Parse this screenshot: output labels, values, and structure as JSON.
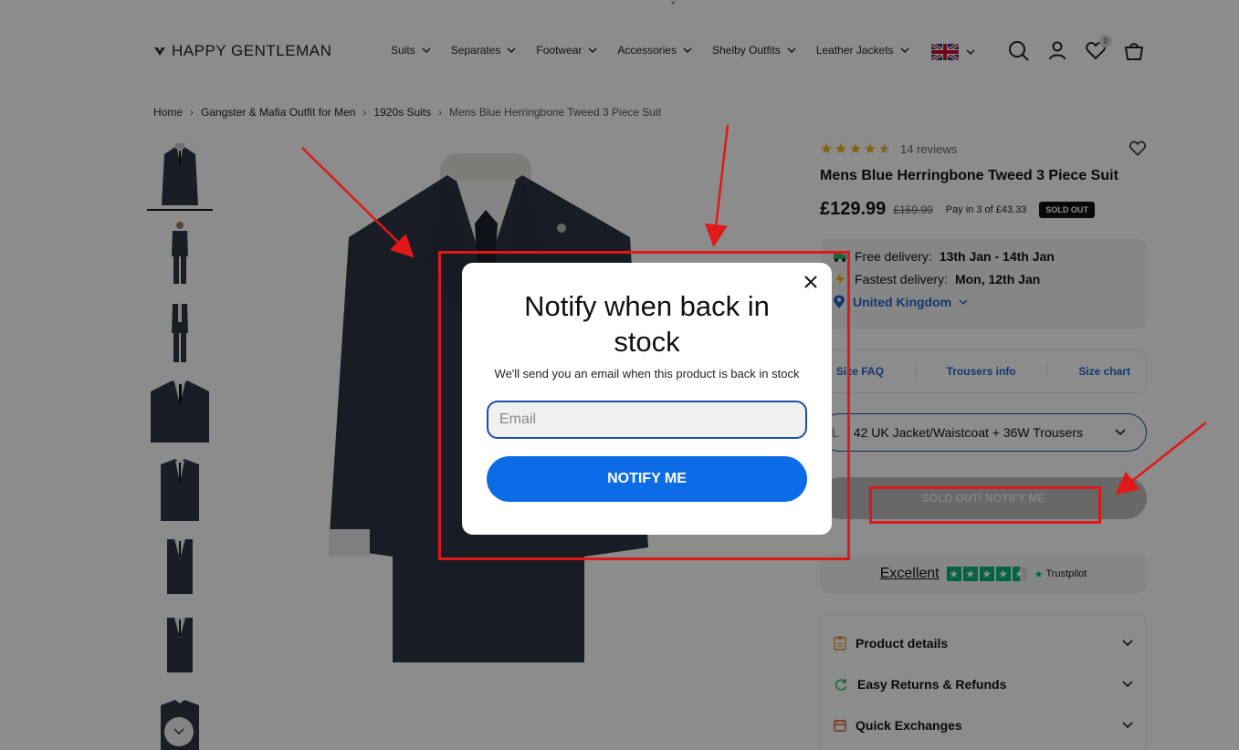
{
  "header": {
    "logo_text": "HAPPY GENTLEMAN",
    "nav": [
      {
        "label": "Suits"
      },
      {
        "label": "Separates"
      },
      {
        "label": "Footwear"
      },
      {
        "label": "Accessories"
      },
      {
        "label": "Shelby Outfits"
      },
      {
        "label": "Leather Jackets"
      }
    ],
    "wishlist_count": "0",
    "icons": [
      "search-icon",
      "account-icon",
      "heart-icon",
      "bag-icon"
    ]
  },
  "breadcrumb": {
    "items": [
      "Home",
      "Gangster & Mafia Outfit for Men",
      "1920s Suits"
    ],
    "current": "Mens Blue Herringbone Tweed 3 Piece Suit"
  },
  "product": {
    "reviews": "14 reviews",
    "rating": 4.5,
    "title": "Mens Blue Herringbone Tweed 3 Piece Suit",
    "price": "£129.99",
    "old_price": "£159.99",
    "installment": "Pay in 3 of £43.33",
    "badge": "SOLD OUT",
    "delivery": {
      "free_label": "Free delivery:",
      "free_dates": "13th Jan - 14th Jan",
      "fast_label": "Fastest delivery:",
      "fast_date": "Mon, 12th Jan",
      "country": "United Kingdom"
    },
    "links": [
      "Size FAQ",
      "Trousers info",
      "Size chart"
    ],
    "size_label": "L",
    "size_value": "42 UK Jacket/Waistcoat + 36W Trousers",
    "soldout_button": "SOLD OUT! NOTIFY ME",
    "trust": {
      "word": "Excellent",
      "brand": "Trustpilot"
    },
    "accordion": [
      "Product details",
      "Easy Returns & Refunds",
      "Quick Exchanges"
    ]
  },
  "modal": {
    "title": "Notify when back in stock",
    "subtitle": "We'll send you an email when this product is back in stock",
    "email_placeholder": "Email",
    "button": "NOTIFY ME"
  },
  "colors": {
    "accent_blue": "#0c6ce6",
    "annotation_red": "#e01818",
    "trustpilot_green": "#00b67a"
  }
}
